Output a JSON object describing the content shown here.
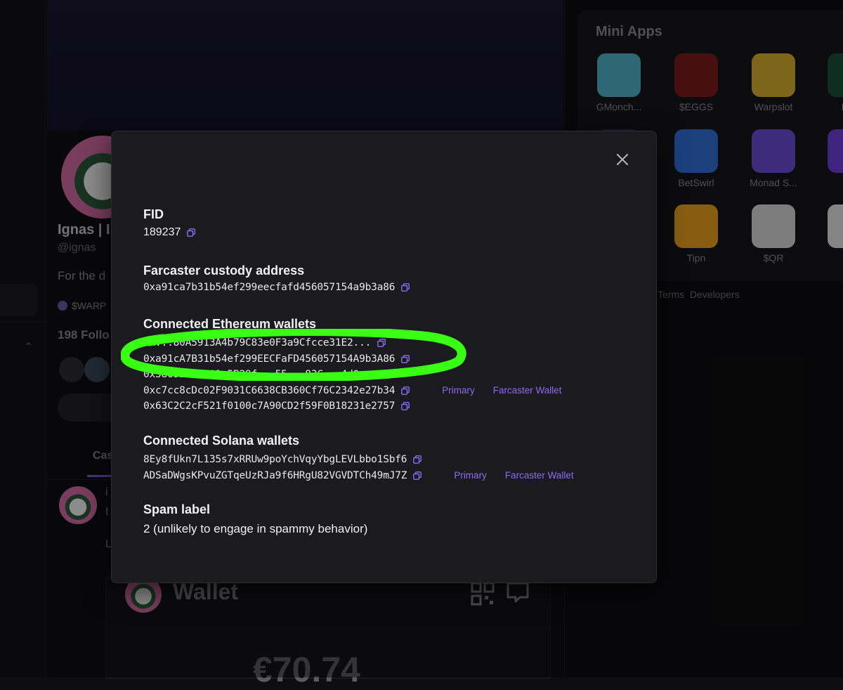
{
  "profile": {
    "name": "Ignas | I",
    "handle": "@ignas",
    "bio": "For the d",
    "warp": "$WARP",
    "followers": "198 Follo",
    "tab": "Cas"
  },
  "feed": {
    "line1": "i",
    "line2": "I",
    "line3": "L"
  },
  "wallet": {
    "title": "Wallet",
    "amount": "€70.74"
  },
  "mini_apps": {
    "title": "Mini Apps",
    "apps": [
      {
        "label": "GMonch...",
        "icon": "gm-icon",
        "color": "#4fb3c9"
      },
      {
        "label": "$EGGS",
        "icon": "eggs-icon",
        "color": "#7a1a1a"
      },
      {
        "label": "Warpslot",
        "icon": "warpslot-icon",
        "color": "#d8b030"
      },
      {
        "label": "Min",
        "icon": "mini-icon",
        "color": "#1d4f3c"
      },
      {
        "label": "",
        "icon": "purple-app-icon",
        "color": "#3a2a6a"
      },
      {
        "label": "BetSwirl",
        "icon": "betswirl-icon",
        "color": "#2f6fd6"
      },
      {
        "label": "Monad S...",
        "icon": "monad-icon",
        "color": "#6b4ad6"
      },
      {
        "label": "Fa",
        "icon": "fa-icon",
        "color": "#6d3fd8"
      },
      {
        "label": "Tipn",
        "icon": "tipn-icon",
        "color": "#e8a020"
      },
      {
        "label": "$QR",
        "icon": "qr-app-icon",
        "color": "#d8d8d8"
      },
      {
        "label": "n",
        "icon": "n-app-icon",
        "color": "#e6e6e6"
      }
    ],
    "footer": [
      "Terms",
      "Developers"
    ]
  },
  "modal": {
    "fid_title": "FID",
    "fid_value": "189237",
    "custody_title": "Farcaster custody address",
    "custody_value": "0xa91ca7b31b54ef299eecfafd456057154a9b3a86",
    "eth_title": "Connected Ethereum wallets",
    "eth_wallets": [
      {
        "address": "0x...80A5913A4b79C83e0F3a9Cfcce31E2...",
        "tags": []
      },
      {
        "address": "0xa91cA7B31b54ef299EECFaFD456057154A9b3A86",
        "tags": []
      },
      {
        "address": "0x5869550C301e5B29f...55...83C...4d0...",
        "tags": []
      },
      {
        "address": "0xc7cc8cDc02F9031C6638CB360Cf76C2342e27b34",
        "tags": [
          "Primary",
          "Farcaster Wallet"
        ]
      },
      {
        "address": "0x63C2C2cF521f0100c7A90CD2f59F0B18231e2757",
        "tags": []
      }
    ],
    "sol_title": "Connected Solana wallets",
    "sol_wallets": [
      {
        "address": "8Ey8fUkn7L135s7xRRUw9poYchVqyYbgLEVLbbo1Sbf6",
        "tags": []
      },
      {
        "address": "ADSaDWgsKPvuZGTqeUzRJa9f6HRgU82VGVDTCh49mJ7Z",
        "tags": [
          "Primary",
          "Farcaster Wallet"
        ]
      }
    ],
    "spam_title": "Spam label",
    "spam_value": "2 (unlikely to engage in spammy behavior)"
  },
  "colors": {
    "accent": "#8a6cf0",
    "highlight": "#39ff14",
    "modal_bg": "#1b1b1f"
  }
}
